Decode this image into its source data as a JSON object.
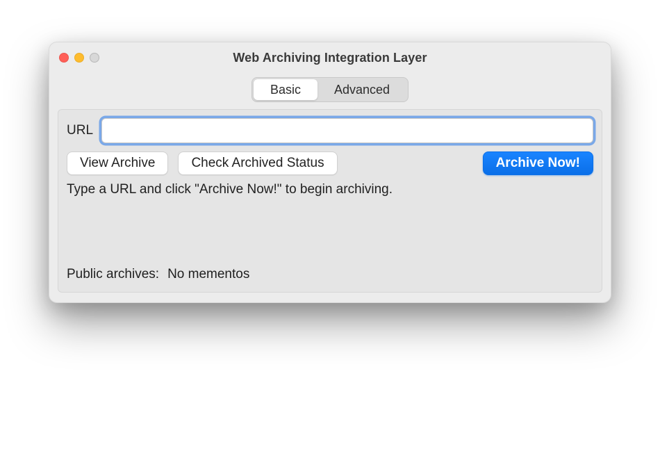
{
  "window": {
    "title": "Web Archiving Integration Layer"
  },
  "tabs": {
    "basic": "Basic",
    "advanced": "Advanced",
    "active": "basic"
  },
  "form": {
    "url_label": "URL",
    "url_value": "",
    "url_placeholder": ""
  },
  "buttons": {
    "view_archive": "View Archive",
    "check_status": "Check Archived Status",
    "archive_now": "Archive Now!"
  },
  "instructions": "Type a URL and click \"Archive Now!\" to begin archiving.",
  "archives": {
    "label": "Public archives:",
    "status": "No mementos"
  }
}
